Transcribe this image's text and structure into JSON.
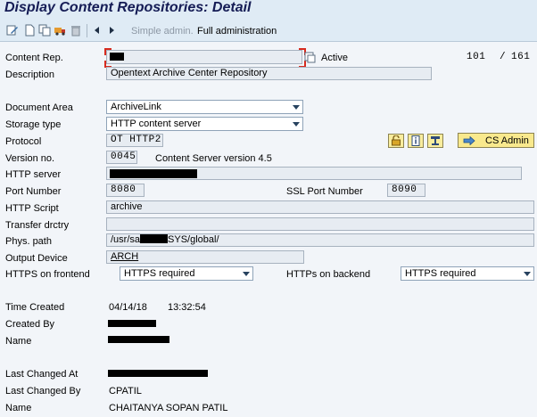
{
  "title": "Display Content Repositories: Detail",
  "toolbar": {
    "simple_admin": "Simple admin.",
    "full_admin": "Full administration",
    "icons": [
      "edit-icon",
      "create-icon",
      "copy-icon",
      "transport-icon",
      "delete-icon",
      "previous-icon",
      "next-icon"
    ]
  },
  "repo": {
    "label": "Content Rep.",
    "value": "",
    "status": "Active",
    "page_current": "101",
    "page_sep": "/",
    "page_total": "161"
  },
  "description": {
    "label": "Description",
    "value": "Opentext Archive Center Repository"
  },
  "document_area": {
    "label": "Document Area",
    "value": "ArchiveLink"
  },
  "storage_type": {
    "label": "Storage type",
    "value": "HTTP content server"
  },
  "protocol": {
    "label": "Protocol",
    "value": "OT HTTP2"
  },
  "version": {
    "label": "Version no.",
    "value": "0045",
    "text": "Content Server version 4.5"
  },
  "cs_admin": "CS Admin",
  "http_server": {
    "label": "HTTP server",
    "value": ""
  },
  "port": {
    "label": "Port Number",
    "value": "8080"
  },
  "ssl_port": {
    "label": "SSL Port Number",
    "value": "8090"
  },
  "http_script": {
    "label": "HTTP Script",
    "value": "archive"
  },
  "transfer_dir": {
    "label": "Transfer drctry",
    "value": ""
  },
  "phys_path": {
    "label": "Phys. path",
    "value_prefix": "/usr/sa",
    "value_suffix": "SYS/global/"
  },
  "output_device": {
    "label": "Output Device",
    "value": "ARCH"
  },
  "https_frontend": {
    "label": "HTTPS on frontend",
    "value": "HTTPS required"
  },
  "https_backend": {
    "label": "HTTPs on backend",
    "value": "HTTPS required"
  },
  "time_created": {
    "label": "Time Created",
    "date": "04/14/18",
    "time": "13:32:54"
  },
  "created_by": {
    "label": "Created By"
  },
  "created_name": {
    "label": "Name"
  },
  "last_changed_at": {
    "label": "Last Changed At"
  },
  "last_changed_by": {
    "label": "Last Changed By",
    "value": "CPATIL"
  },
  "changed_name": {
    "label": "Name",
    "value": "CHAITANYA SOPAN PATIL"
  },
  "colors": {
    "title": "#151c55",
    "header_bg": "#dfebf5",
    "form_bg": "#f2f5f9",
    "button_yellow": "#f9e98d"
  }
}
